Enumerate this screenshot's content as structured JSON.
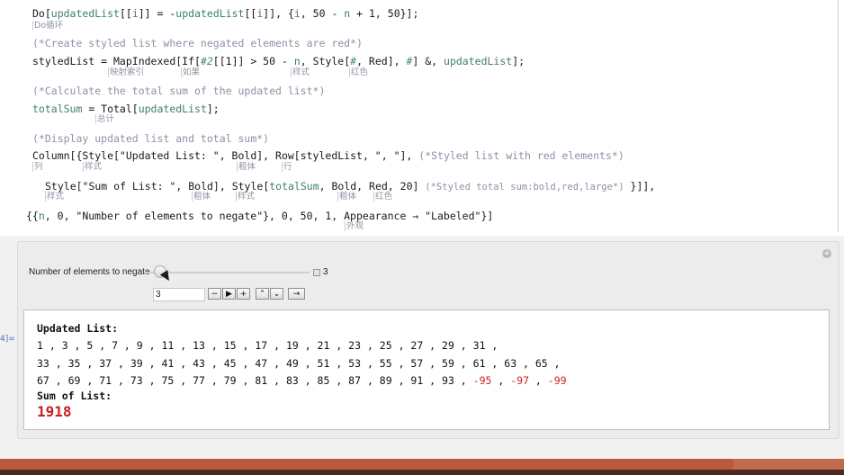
{
  "code": {
    "line1": {
      "p1": "Do[",
      "v1": "updatedList",
      "p2": "[[",
      "i1": "i",
      "p3": "]] = -",
      "v2": "updatedList",
      "p4": "[[",
      "i2": "i",
      "p5": "]], {",
      "i3": "i",
      "p6": ", 50 - ",
      "n": "n",
      "p7": " + 1, 50}];"
    },
    "hint_do": "Do循环",
    "comment1": "(*Create styled list where negated elements are red*)",
    "line2": {
      "p1": "styledList = MapIndexed[If[",
      "a": "#2",
      "p2": "[[1]] > 50 - ",
      "n": "n",
      "p3": ", Style[",
      "b": "#",
      "p4": ", Red], ",
      "c": "#",
      "p5": "] &, ",
      "v": "updatedList",
      "p6": "];"
    },
    "hint_mapindexed": "映射索引",
    "hint_if": "如果",
    "hint_style1": "样式",
    "hint_red1": "红色",
    "comment2": "(*Calculate the total sum of the updated list*)",
    "line3": {
      "v1": "totalSum",
      "p1": " = Total[",
      "v2": "updatedList",
      "p2": "];"
    },
    "hint_total": "总计",
    "comment3": "(*Display updated list and total sum*)",
    "line4": {
      "p1": "Column[{Style[\"Updated List: \", Bold], Row[styledList, \", \"], ",
      "cm": "(*Styled list with red elements*)"
    },
    "hint_column": "列",
    "hint_style2": "样式",
    "hint_bold1": "粗体",
    "hint_row": "行",
    "line5": {
      "p1": "Style[\"Sum of List: \", Bold], Style[",
      "v": "totalSum",
      "p2": ", Bold, Red, 20] ",
      "cm": "(*Styled total sum:bold,red,large*)",
      "p3": " }]],"
    },
    "hint_style3": "样式",
    "hint_bold2": "粗体",
    "hint_style4": "样式",
    "hint_bold3": "粗体",
    "hint_red2": "红色",
    "line6": {
      "p1": "{{",
      "n": "n",
      "p2": ", 0, \"Number of elements to negate\"}, 0, 50, 1, Appearance → \"Labeled\"}]"
    },
    "hint_appearance": "外观"
  },
  "manipulate": {
    "slider_label": "Number of elements to negate",
    "slider_value": "3",
    "slider_fraction": 0.06,
    "input_value": "3",
    "buttons": {
      "minus": "−",
      "play": "▶",
      "plus": "+",
      "faster": "⌃",
      "slower": "⌄",
      "direction": "→"
    },
    "output": {
      "updated_label": "Updated List:",
      "line1": "1 , 3 , 5 , 7 , 9 , 11 , 13 , 15 , 17 , 19 , 21 , 23 , 25 , 27 , 29 , 31 ,",
      "line2": "33 , 35 , 37 , 39 , 41 , 43 , 45 , 47 , 49 , 51 , 53 , 55 , 57 , 59 , 61 , 63 , 65 ,",
      "line3_black": "67 , 69 , 71 , 73 , 75 , 77 , 79 , 81 , 83 , 85 , 87 , 89 , 91 , 93 , ",
      "neg1": "-95",
      "sep1": " , ",
      "neg2": "-97",
      "sep2": " , ",
      "neg3": "-99",
      "sum_label": "Sum of List:",
      "sum_value": "1918"
    }
  },
  "output_cell_label": "4]=",
  "colors": {
    "accent_red": "#cc1f1f",
    "variable_green": "#3f7f6a",
    "comment_gray": "#8a93a5"
  }
}
